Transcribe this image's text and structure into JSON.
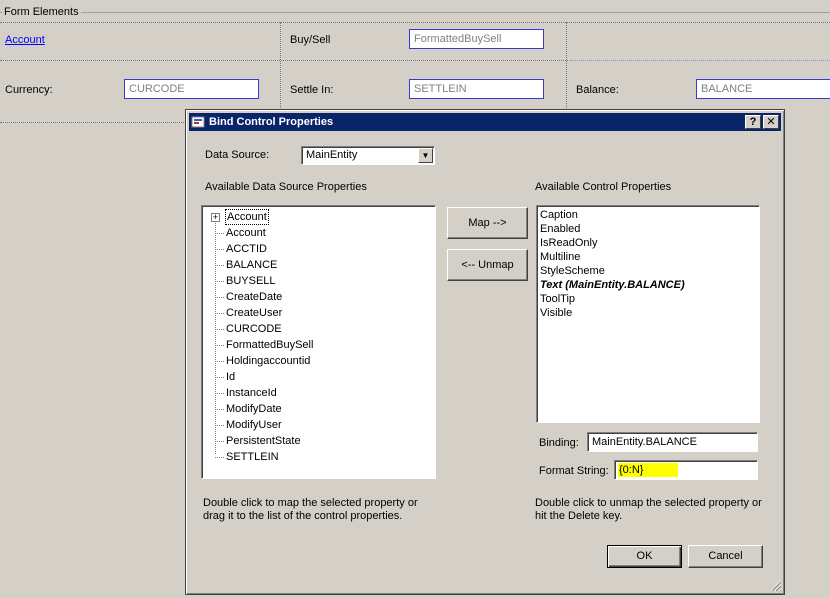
{
  "form": {
    "group_title": "Form Elements",
    "account_link": "Account",
    "buysell_label": "Buy/Sell",
    "buysell_value": "FormattedBuySell",
    "currency_label": "Currency:",
    "currency_value": "CURCODE",
    "settle_label": "Settle In:",
    "settle_value": "SETTLEIN",
    "balance_label": "Balance:",
    "balance_value": "BALANCE"
  },
  "dialog": {
    "title": "Bind Control Properties",
    "help_btn": "?",
    "close_btn": "✕",
    "data_source_label": "Data Source:",
    "data_source_value": "MainEntity",
    "available_ds_label": "Available Data Source Properties",
    "ds_root": "Account",
    "ds_properties": [
      "Account",
      "ACCTID",
      "BALANCE",
      "BUYSELL",
      "CreateDate",
      "CreateUser",
      "CURCODE",
      "FormattedBuySell",
      "Holdingaccountid",
      "Id",
      "InstanceId",
      "ModifyDate",
      "ModifyUser",
      "PersistentState",
      "SETTLEIN"
    ],
    "map_btn": "Map -->",
    "unmap_btn": "<-- Unmap",
    "available_cp_label": "Available Control Properties",
    "control_properties": [
      "Caption",
      "Enabled",
      "IsReadOnly",
      "Multiline",
      "StyleScheme",
      "Text (MainEntity.BALANCE)",
      "ToolTip",
      "Visible"
    ],
    "binding_label": "Binding:",
    "binding_value": "MainEntity.BALANCE",
    "format_label": "Format String:",
    "format_value": "{0:N}",
    "left_note": "Double click to map the selected property or drag it to the list of the control properties.",
    "right_note": "Double click to unmap the selected property or hit the Delete key.",
    "ok_btn": "OK",
    "cancel_btn": "Cancel"
  },
  "colors": {
    "titlebar": "#0a246a",
    "highlight": "#ffff00",
    "link": "#0000ff"
  }
}
